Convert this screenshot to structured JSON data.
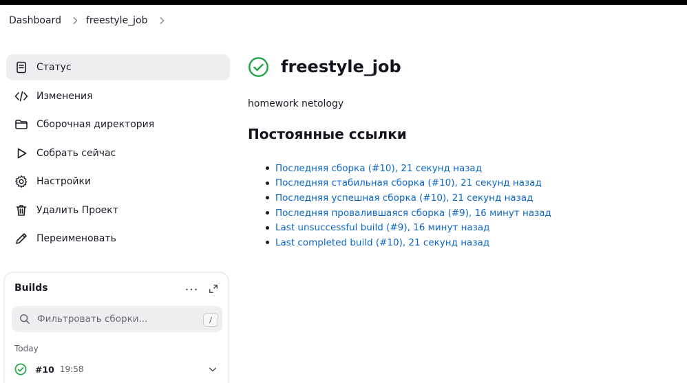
{
  "breadcrumb": {
    "items": [
      "Dashboard",
      "freestyle_job"
    ]
  },
  "sidebar": {
    "items": [
      {
        "label": "Статус",
        "icon": "document-icon",
        "active": true
      },
      {
        "label": "Изменения",
        "icon": "code-icon"
      },
      {
        "label": "Сборочная директория",
        "icon": "folder-icon"
      },
      {
        "label": "Собрать сейчас",
        "icon": "play-icon"
      },
      {
        "label": "Настройки",
        "icon": "gear-icon"
      },
      {
        "label": "Удалить Проект",
        "icon": "trash-icon"
      },
      {
        "label": "Переименовать",
        "icon": "pencil-icon"
      }
    ]
  },
  "builds": {
    "title": "Builds",
    "filter_placeholder": "Фильтровать сборки...",
    "shortcut": "/",
    "date_group": "Today",
    "rows": [
      {
        "number": "#10",
        "time": "19:58",
        "status": "success"
      }
    ]
  },
  "main": {
    "title": "freestyle_job",
    "description": "homework netology",
    "section_title": "Постоянные ссылки",
    "permalinks": [
      "Последняя сборка (#10), 21 секунд назад",
      "Последняя стабильная сборка (#10), 21 секунд назад",
      "Последняя успешная сборка (#10), 21 секунд назад",
      "Последняя провалившаяся сборка (#9), 16 минут назад",
      "Last unsuccessful build (#9), 16 минут назад",
      "Last completed build (#10), 21 секунд назад"
    ]
  },
  "colors": {
    "success": "#1ea446",
    "link": "#0b67c7",
    "active_bg": "#eeeef0"
  }
}
